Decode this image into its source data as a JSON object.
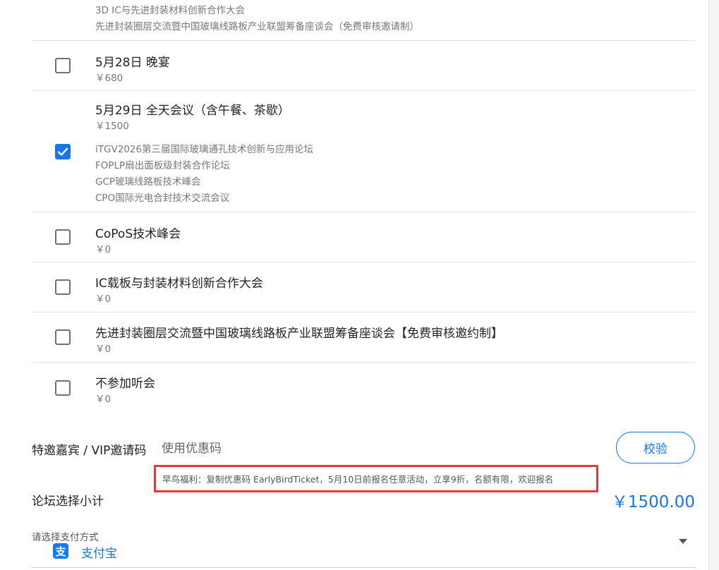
{
  "top_item": {
    "desc_lines": [
      "3D IC与先进封装材料创新合作大会",
      "先进封装圈层交流暨中国玻璃线路板产业联盟筹备座谈会（免费审核邀请制）"
    ]
  },
  "items": [
    {
      "title": "5月28日 晚宴",
      "price": "￥680",
      "checked": false,
      "desc_lines": []
    },
    {
      "title": "5月29日 全天会议（含午餐、茶歇）",
      "price": "￥1500",
      "checked": true,
      "desc_lines": [
        "iTGV2026第三届国际玻璃通孔技术创新与应用论坛",
        "FOPLP扇出面板级封装合作论坛",
        "GCP玻璃线路板技术峰会",
        "CPO国际光电合封技术交流会议"
      ]
    },
    {
      "title": "CoPoS技术峰会",
      "price": "￥0",
      "checked": false,
      "desc_lines": []
    },
    {
      "title": "IC载板与封装材料创新合作大会",
      "price": "￥0",
      "checked": false,
      "desc_lines": []
    },
    {
      "title": "先进封装圈层交流暨中国玻璃线路板产业联盟筹备座谈会【免费审核邀约制】",
      "price": "￥0",
      "checked": false,
      "desc_lines": []
    },
    {
      "title": "不参加听会",
      "price": "￥0",
      "checked": false,
      "desc_lines": []
    }
  ],
  "coupon": {
    "label": "特邀嘉宾 / VIP邀请码",
    "placeholder": "使用优惠码",
    "value": "",
    "verify_label": "校验",
    "promo_text": "早鸟福利：复制优惠码 EarlyBirdTicket，5月10日前报名任意活动，立享9折，名额有限，欢迎报名"
  },
  "subtotal": {
    "label": "论坛选择小计",
    "value": "￥1500.00"
  },
  "payment": {
    "label": "请选择支付方式",
    "icon": "alipay-icon",
    "icon_glyph": "支",
    "selected": "支付宝"
  },
  "colors": {
    "accent": "#1a73e8",
    "promo_border": "#e53935",
    "alipay": "#1677ff"
  }
}
